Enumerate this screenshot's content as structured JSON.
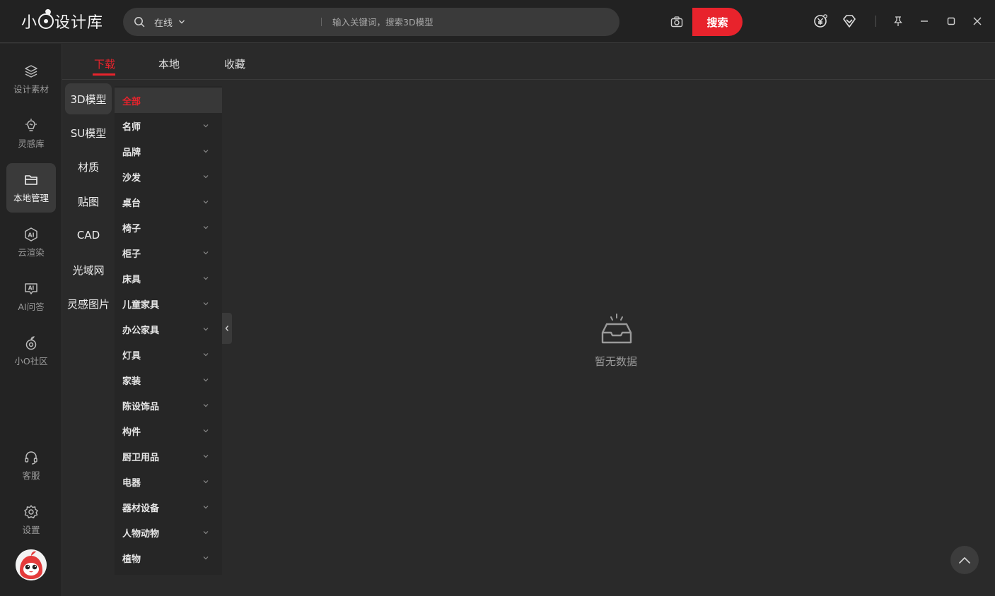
{
  "app": {
    "logo_left": "小",
    "logo_right": "设计库"
  },
  "search": {
    "scope": "在线",
    "placeholder": "输入关键词，搜索3D模型",
    "button": "搜索"
  },
  "leftnav": {
    "items": [
      {
        "label": "设计素材",
        "icon": "layers-icon"
      },
      {
        "label": "灵感库",
        "icon": "lightbulb-icon"
      },
      {
        "label": "本地管理",
        "icon": "folder-icon"
      },
      {
        "label": "云渲染",
        "icon": "ai-render-icon"
      },
      {
        "label": "AI问答",
        "icon": "ai-chat-icon"
      },
      {
        "label": "小O社区",
        "icon": "community-icon"
      }
    ],
    "bottom": [
      {
        "label": "客服",
        "icon": "headset-icon"
      },
      {
        "label": "设置",
        "icon": "gear-icon"
      }
    ]
  },
  "tabs": [
    "下载",
    "本地",
    "收藏"
  ],
  "categories": [
    "3D模型",
    "SU模型",
    "材质",
    "贴图",
    "CAD",
    "光域网",
    "灵感图片"
  ],
  "subcategories": [
    "全部",
    "名师",
    "品牌",
    "沙发",
    "桌台",
    "椅子",
    "柜子",
    "床具",
    "儿童家具",
    "办公家具",
    "灯具",
    "家装",
    "陈设饰品",
    "构件",
    "厨卫用品",
    "电器",
    "器材设备",
    "人物动物",
    "植物"
  ],
  "empty": {
    "text": "暂无数据"
  },
  "colors": {
    "accent": "#e8232c",
    "background": "#2a2a2a"
  }
}
